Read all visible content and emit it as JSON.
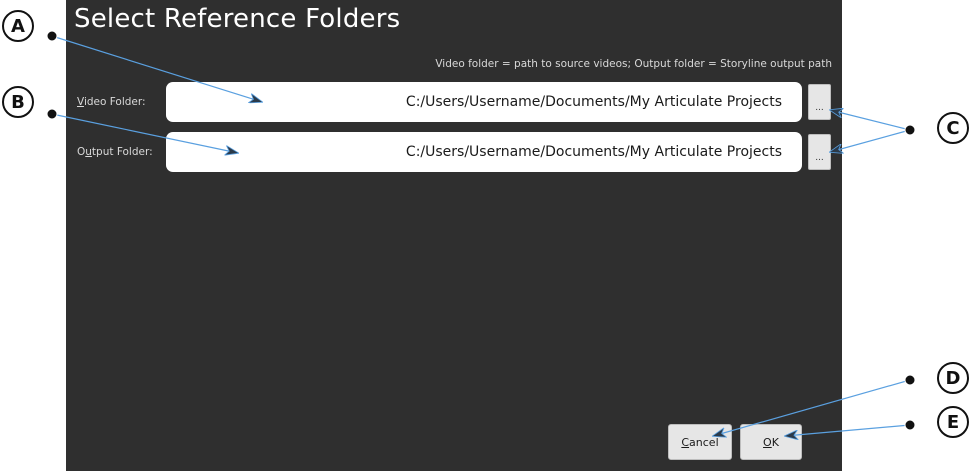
{
  "dialog": {
    "title": "Select Reference Folders",
    "hint": "Video folder = path to source videos; Output folder = Storyline output path"
  },
  "video_folder": {
    "label_mnemonic": "V",
    "label_rest": "ideo Folder:",
    "value": "C:/Users/Username/Documents/My Articulate Projects",
    "browse_label": "..."
  },
  "output_folder": {
    "label_prefix": "O",
    "label_mnemonic": "u",
    "label_rest": "tput Folder:",
    "value": "C:/Users/Username/Documents/My Articulate Projects",
    "browse_label": "..."
  },
  "buttons": {
    "cancel_mnemonic": "C",
    "cancel_rest": "ancel",
    "ok_mnemonic": "O",
    "ok_rest": "K"
  },
  "callouts": {
    "a": "A",
    "b": "B",
    "c": "C",
    "d": "D",
    "e": "E"
  },
  "colors": {
    "dialog_bg": "#2f2f2f",
    "callout_line": "#5aa0e0"
  }
}
